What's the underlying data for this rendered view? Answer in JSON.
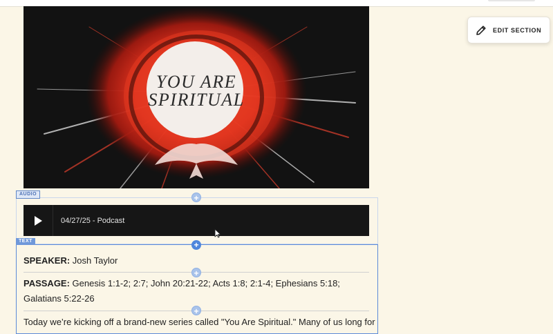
{
  "hero": {
    "title_line1": "YOU ARE",
    "title_line2": "SPIRITUAL"
  },
  "edit_section": {
    "label": "EDIT SECTION",
    "icon": "pencil-icon"
  },
  "blocks": {
    "audio_tag": "AUDIO",
    "text_tag": "TEXT",
    "add_icon": "+"
  },
  "audio": {
    "play_icon": "play-icon",
    "track_title": "04/27/25 - Podcast"
  },
  "text": {
    "speaker_label": "SPEAKER:",
    "speaker_value": " Josh Taylor",
    "passage_label": "PASSAGE:",
    "passage_value": " Genesis 1:1-2; 2:7; John 20:21-22; Acts 1:8; 2:1-4; Ephesians 5:18; Galatians 5:22-26",
    "intro": "Today we’re kicking off a brand-new series called \"You Are Spiritual.\" Many of us long for"
  },
  "colors": {
    "page_bg": "#fbf6e7",
    "accent_blue": "#4f86dc",
    "player_bg": "#161616"
  }
}
